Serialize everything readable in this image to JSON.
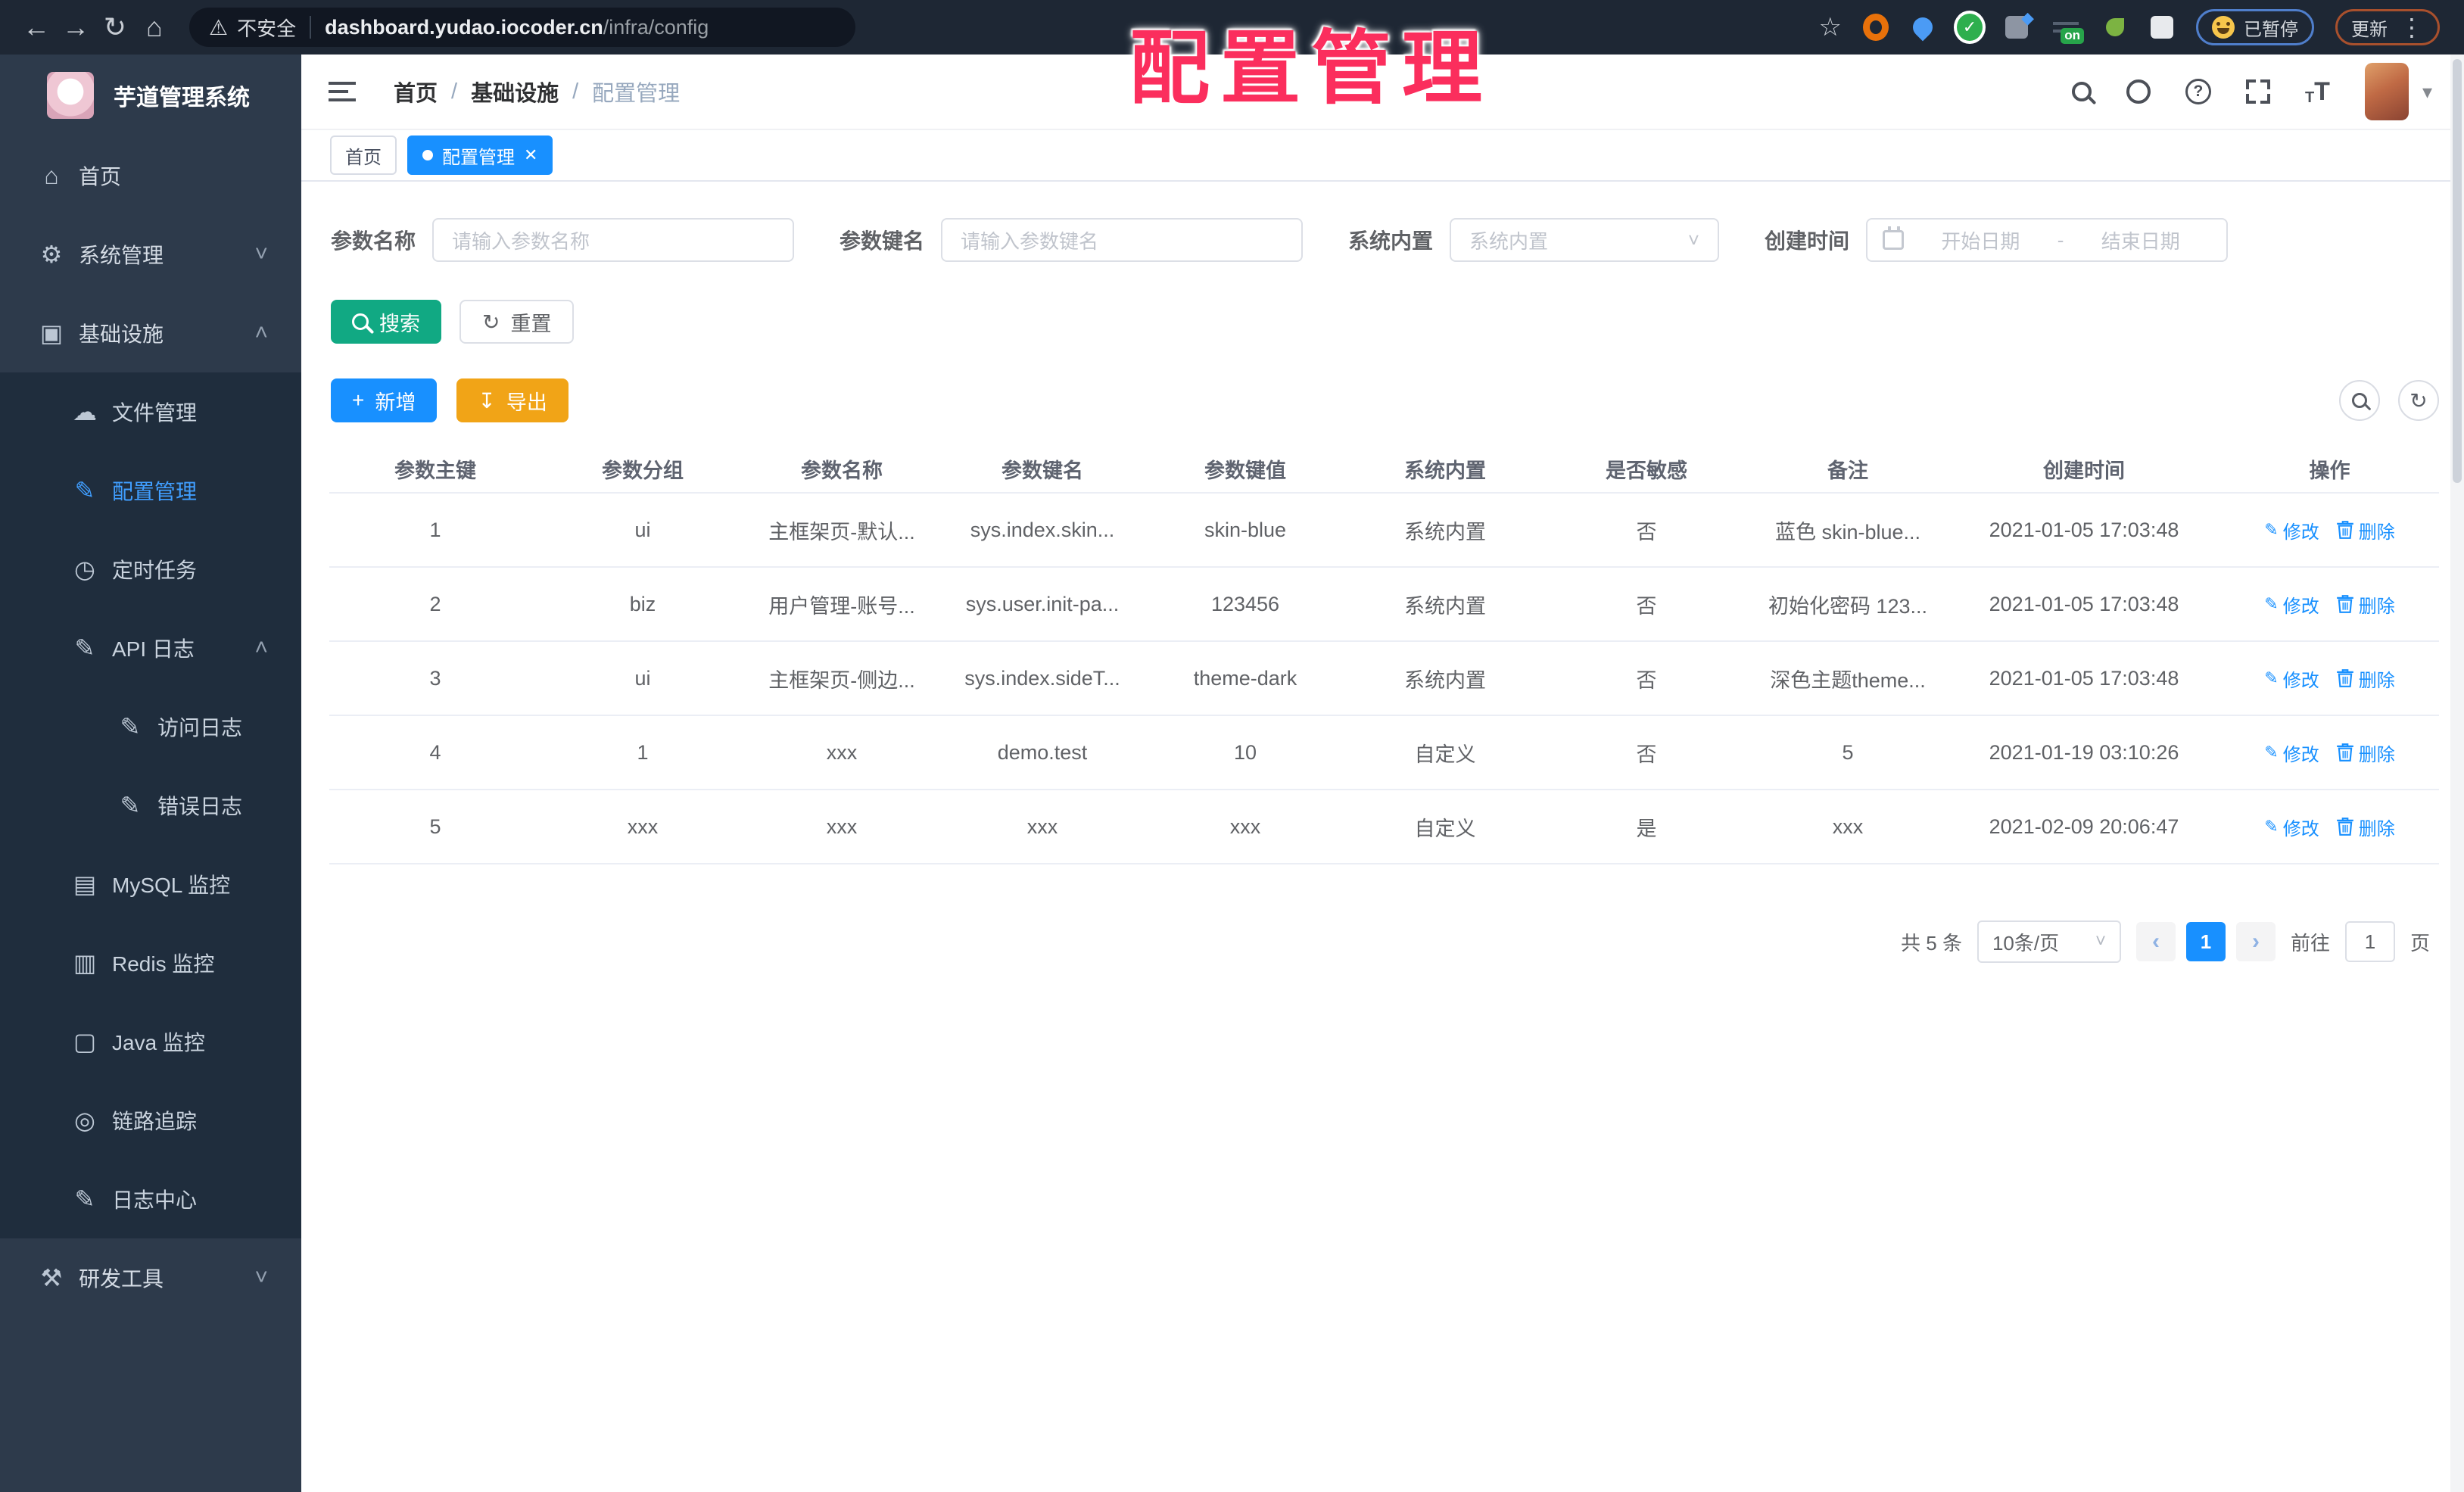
{
  "overlay": {
    "title": "配置管理"
  },
  "browser": {
    "security_label": "不安全",
    "url_host": "dashboard.yudao.iocoder.cn",
    "url_path": "/infra/config",
    "on_badge": "on",
    "paused_label": "已暂停",
    "update_label": "更新"
  },
  "icons": {
    "back": "←",
    "forward": "→",
    "reload": "↻",
    "home": "⌂",
    "warning": "⚠",
    "star": "☆",
    "check": "✓",
    "dots": "⋮",
    "caret": "▾",
    "question": "?",
    "chevron_down": "˅",
    "chevron_up": "˄",
    "close": "✕",
    "refresh": "↻",
    "plus": "+",
    "download": "↧",
    "edit": "✎",
    "prev": "‹",
    "next": "›",
    "menu_glyphs": {
      "home-icon": "⌂",
      "gear-icon": "⚙",
      "infra-icon": "▣",
      "cloud-icon": "☁",
      "edit-icon": "✎",
      "timer-icon": "◷",
      "log-icon": "✎",
      "mysql-icon": "▤",
      "redis-icon": "▥",
      "java-icon": "▢",
      "trace-icon": "◎",
      "tools-icon": "⚒"
    }
  },
  "sidebar": {
    "app_title": "芋道管理系统",
    "menu": [
      {
        "label": "首页",
        "level": 1,
        "icon": "home-icon"
      },
      {
        "label": "系统管理",
        "level": 1,
        "icon": "gear-icon",
        "chevron": "down"
      },
      {
        "label": "基础设施",
        "level": 1,
        "icon": "infra-icon",
        "chevron": "up"
      },
      {
        "label": "文件管理",
        "level": 2,
        "icon": "cloud-icon"
      },
      {
        "label": "配置管理",
        "level": 2,
        "icon": "edit-icon",
        "active": true
      },
      {
        "label": "定时任务",
        "level": 2,
        "icon": "timer-icon"
      },
      {
        "label": "API 日志",
        "level": 2,
        "icon": "log-icon",
        "chevron": "up"
      },
      {
        "label": "访问日志",
        "level": 3,
        "icon": "log-icon"
      },
      {
        "label": "错误日志",
        "level": 3,
        "icon": "log-icon"
      },
      {
        "label": "MySQL 监控",
        "level": 2,
        "icon": "mysql-icon"
      },
      {
        "label": "Redis 监控",
        "level": 2,
        "icon": "redis-icon"
      },
      {
        "label": "Java 监控",
        "level": 2,
        "icon": "java-icon"
      },
      {
        "label": "链路追踪",
        "level": 2,
        "icon": "trace-icon"
      },
      {
        "label": "日志中心",
        "level": 2,
        "icon": "log-icon"
      },
      {
        "label": "研发工具",
        "level": 1,
        "icon": "tools-icon",
        "chevron": "down"
      }
    ]
  },
  "header": {
    "breadcrumb": [
      "首页",
      "基础设施",
      "配置管理"
    ]
  },
  "tags": [
    {
      "label": "首页",
      "active": false
    },
    {
      "label": "配置管理",
      "active": true,
      "closable": true
    }
  ],
  "filters": {
    "name_label": "参数名称",
    "name_placeholder": "请输入参数名称",
    "key_label": "参数键名",
    "key_placeholder": "请输入参数键名",
    "type_label": "系统内置",
    "type_placeholder": "系统内置",
    "date_label": "创建时间",
    "date_start": "开始日期",
    "date_sep": "-",
    "date_end": "结束日期",
    "search": "搜索",
    "reset": "重置"
  },
  "toolbar": {
    "add": "新增",
    "export": "导出"
  },
  "table": {
    "columns": [
      "参数主键",
      "参数分组",
      "参数名称",
      "参数键名",
      "参数键值",
      "系统内置",
      "是否敏感",
      "备注",
      "创建时间",
      "操作"
    ],
    "rows": [
      [
        "1",
        "ui",
        "主框架页-默认...",
        "sys.index.skin...",
        "skin-blue",
        "系统内置",
        "否",
        "蓝色 skin-blue...",
        "2021-01-05 17:03:48"
      ],
      [
        "2",
        "biz",
        "用户管理-账号...",
        "sys.user.init-pa...",
        "123456",
        "系统内置",
        "否",
        "初始化密码 123...",
        "2021-01-05 17:03:48"
      ],
      [
        "3",
        "ui",
        "主框架页-侧边...",
        "sys.index.sideT...",
        "theme-dark",
        "系统内置",
        "否",
        "深色主题theme...",
        "2021-01-05 17:03:48"
      ],
      [
        "4",
        "1",
        "xxx",
        "demo.test",
        "10",
        "自定义",
        "否",
        "5",
        "2021-01-19 03:10:26"
      ],
      [
        "5",
        "xxx",
        "xxx",
        "xxx",
        "xxx",
        "自定义",
        "是",
        "xxx",
        "2021-02-09 20:06:47"
      ]
    ],
    "op_edit": "修改",
    "op_delete": "删除"
  },
  "pagination": {
    "total": "共 5 条",
    "page_size": "10条/页",
    "current": "1",
    "goto_label": "前往",
    "goto_value": "1",
    "page_unit": "页"
  },
  "colors": {
    "sidebar_bg": "#2d3a4b",
    "submenu_bg": "#1f2d3d",
    "sidebar_active": "#409eff",
    "primary": "#1890ff",
    "search_teal": "#11a983",
    "export_amber": "#f1a417",
    "annotation_red": "#fb2e5d"
  }
}
